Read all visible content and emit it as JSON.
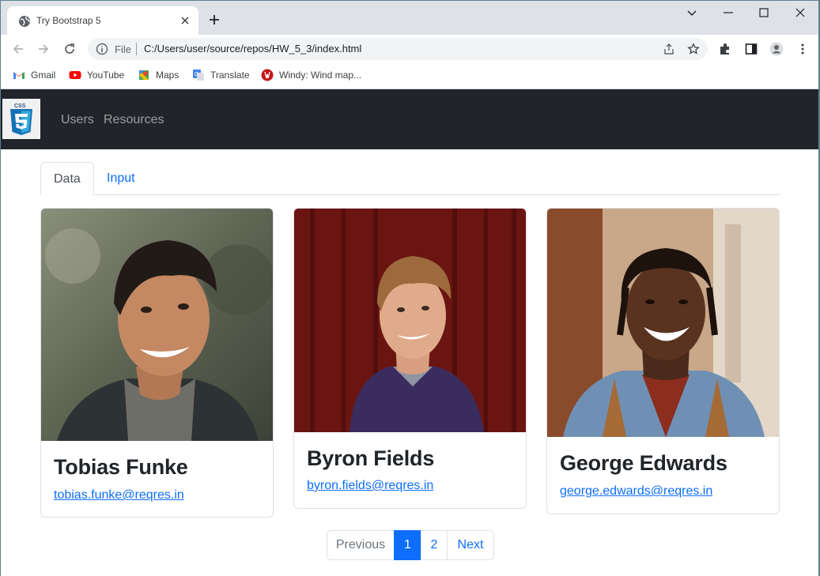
{
  "browser": {
    "tab_title": "Try Bootstrap 5",
    "address": {
      "scheme_label": "File",
      "url": "C:/Users/user/source/repos/HW_5_3/index.html"
    },
    "bookmarks": [
      {
        "label": "Gmail",
        "icon": "gmail-icon"
      },
      {
        "label": "YouTube",
        "icon": "youtube-icon"
      },
      {
        "label": "Maps",
        "icon": "maps-icon"
      },
      {
        "label": "Translate",
        "icon": "translate-icon"
      },
      {
        "label": "Windy: Wind map...",
        "icon": "windy-icon"
      }
    ]
  },
  "navbar": {
    "brand_icon": "css3-logo-icon",
    "links": [
      "Users",
      "Resources"
    ]
  },
  "tabs": [
    {
      "label": "Data",
      "active": true
    },
    {
      "label": "Input",
      "active": false
    }
  ],
  "cards": [
    {
      "name": "Tobias Funke",
      "email": "tobias.funke@reqres.in",
      "photo": "portrait of young man with dark hair smiling outdoors"
    },
    {
      "name": "Byron Fields",
      "email": "byron.fields@reqres.in",
      "photo": "portrait of blond man in purple jacket against red wooden wall"
    },
    {
      "name": "George Edwards",
      "email": "george.edwards@reqres.in",
      "photo": "portrait of laughing man with headphones and denim jacket"
    }
  ],
  "pagination": {
    "previous": "Previous",
    "pages": [
      "1",
      "2"
    ],
    "current": "1",
    "next": "Next"
  },
  "colors": {
    "navbar_bg": "#212529",
    "link": "#0d6efd",
    "active_page": "#0d6efd"
  }
}
